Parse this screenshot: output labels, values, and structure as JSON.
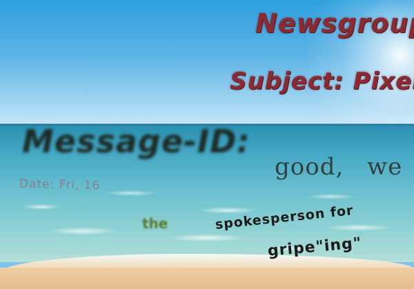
{
  "texts": {
    "newsgroups": "Newsgroups:",
    "subject": "Subject: Pixel",
    "message_id": "Message-ID:",
    "good_we": "good, we",
    "date": "Date: Fri, 16",
    "the": "the",
    "spokesperson": "spokesperson for",
    "griping": "gripe\"ing\""
  },
  "colors": {
    "title_text": "#8a2a32",
    "sky": "#2f9fdd",
    "sea": "#46a9c4",
    "sand": "#e3bd8b"
  }
}
